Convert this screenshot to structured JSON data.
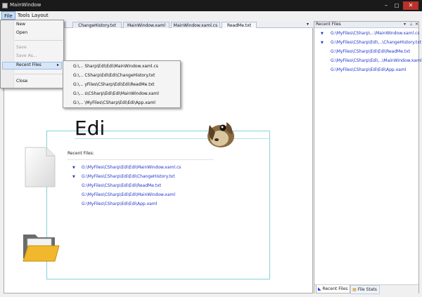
{
  "window": {
    "title": "MainWindow",
    "min": "–",
    "max": "□",
    "close": "✕"
  },
  "menubar": {
    "file": "File",
    "tools": "Tools",
    "layout": "Layout"
  },
  "tabs": [
    {
      "label": "ChangeHistory.txt"
    },
    {
      "label": "MainWindow.xaml"
    },
    {
      "label": "MainWindow.xaml.cs"
    },
    {
      "label": "ReadMe.txt"
    }
  ],
  "tab_overflow": "▾",
  "file_menu": {
    "new": "New",
    "open": "Open",
    "save": "Save",
    "save_as": "Save As...",
    "recent_files": "Recent Files",
    "arrow": "▸",
    "close": "Close"
  },
  "recent_submenu": [
    "G:\\... Sharp\\Edi\\Edi\\MainWindow.xaml.cs",
    "G:\\... CSharp\\Edi\\Edi\\ChangeHistory.txt",
    "G:\\... yFiles\\CSharp\\Edi\\Edi\\ReadMe.txt",
    "G:\\... s\\CSharp\\Edi\\Edi\\MainWindow.xaml",
    "G:\\... \\MyFiles\\CSharp\\Edi\\Edi\\App.xaml"
  ],
  "start_page": {
    "title": "Edi",
    "recent_heading": "Recent Files:",
    "pin": "▼",
    "links": [
      "G:\\MyFiles\\CSharp\\Edi\\Edi\\MainWindow.xaml.cs",
      "G:\\MyFiles\\CSharp\\Edi\\Edi\\ChangeHistory.txt",
      "G:\\MyFiles\\CSharp\\Edi\\Edi\\ReadMe.txt",
      "G:\\MyFiles\\CSharp\\Edi\\Edi\\MainWindow.xaml",
      "G:\\MyFiles\\CSharp\\Edi\\Edi\\App.xaml"
    ]
  },
  "right_panel": {
    "title": "Recent Files",
    "controls": {
      "dropdown": "▾",
      "pin": "⊥",
      "close": "✕"
    },
    "pin": "▼",
    "links": [
      "G:\\MyFiles\\CSharp\\...\\MainWindow.xaml.cs",
      "G:\\MyFiles\\CSharp\\Edi\\...\\ChangeHistory.txt",
      "G:\\MyFiles\\CSharp\\Edi\\Edi\\ReadMe.txt",
      "G:\\MyFiles\\CSharp\\Edi\\...\\MainWindow.xaml",
      "G:\\MyFiles\\CSharp\\Edi\\Edi\\App.xaml"
    ],
    "tabs": {
      "recent": "Recent Files",
      "stats": "File Stats"
    }
  },
  "colors": {
    "link": "#2233cc",
    "frame": "#86d0d9",
    "titlebar": "#1a1a1a",
    "menu_highlight": "#d7e5f8"
  },
  "icons": [
    "app-icon",
    "document-icon",
    "folder-icon",
    "dog-logo-icon",
    "pin-icon",
    "submenu-arrow-icon"
  ]
}
